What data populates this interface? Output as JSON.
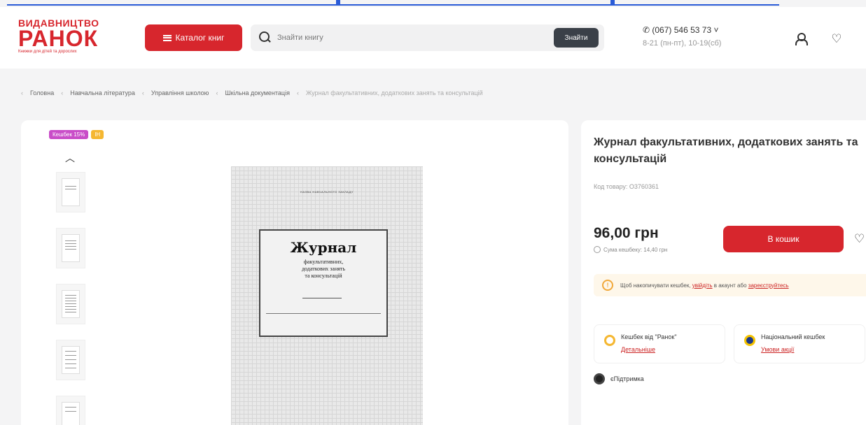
{
  "header": {
    "logo": {
      "line1": "ВИДАВНИЦТВО",
      "line2": "РАНОК",
      "tagline": "Книжки для дітей та дорослих"
    },
    "catalog_label": "Каталог книг",
    "search": {
      "placeholder": "Знайти книгу",
      "button_label": "Знайти"
    },
    "phone": "(067) 546 53 73",
    "hours": "8-21 (пн-пт), 10-19(сб)"
  },
  "breadcrumbs": [
    "Головна",
    "Навчальна література",
    "Управління школою",
    "Шкільна документація",
    "Журнал факультативних, додаткових занять та консультацій"
  ],
  "gallery": {
    "badge_cashback": "Кешбек 15%",
    "badge_new": "ІН",
    "cover": {
      "top_text": "НАЗВА НАВЧАЛЬНОГО ЗАКЛАДУ",
      "title": "Журнал",
      "subtitle": "факультативних,\nдодаткових занять\nта консультацій"
    }
  },
  "product": {
    "title": "Журнал факультативних, додаткових занять та консультацій",
    "sku": "Код товару: О3760361",
    "price": "96,00 грн",
    "cashback_sum": "Сума кешбеку: 14,40 грн",
    "cart_label": "В кошик",
    "notice_text": "Щоб накопичувати кешбек,",
    "notice_link1": "увійдіть",
    "notice_mid": "в акаунт або",
    "notice_link2": "зареєструйтесь",
    "cashback_ranok_title": "Кешбек від \"Ранок\"",
    "cashback_ranok_link": "Детальніше",
    "national_cashback_title": "Національний кешбек",
    "national_cashback_link": "Умови акції",
    "support_label": "єПідтримка"
  },
  "colors": {
    "brand_red": "#d7262d",
    "dark_button": "#3a4048",
    "accent_purple": "#c94dc8",
    "accent_yellow": "#f5b731"
  }
}
